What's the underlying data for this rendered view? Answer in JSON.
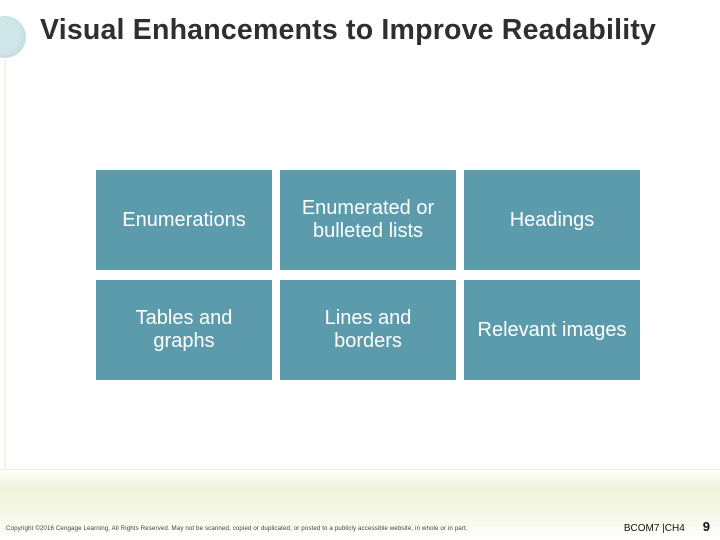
{
  "title": "Visual Enhancements to Improve Readability",
  "cells": [
    "Enumerations",
    "Enumerated or bulleted lists",
    "Headings",
    "Tables and graphs",
    "Lines and borders",
    "Relevant images"
  ],
  "copyright": "Copyright ©2016 Cengage Learning. All Rights Reserved. May not be scanned, copied or duplicated, or posted to a publicly accessible website, in whole or in part.",
  "footer": {
    "code": "BCOM7 |CH4",
    "page": "9"
  }
}
